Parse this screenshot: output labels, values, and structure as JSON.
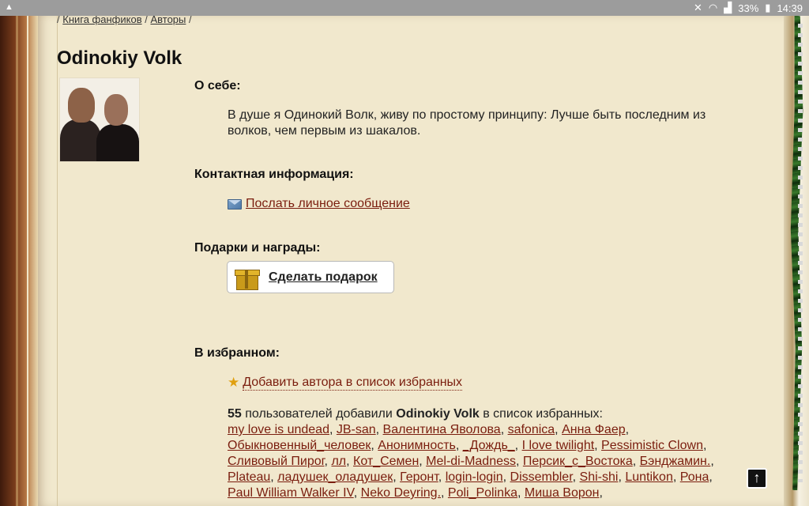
{
  "status_bar": {
    "battery": "33%",
    "time": "14:39"
  },
  "breadcrumb": {
    "separator": "/",
    "items": [
      "Книга фанфиков",
      "Авторы"
    ]
  },
  "author": {
    "name": "Odinokiy Volk"
  },
  "about": {
    "heading": "О себе:",
    "text": "В душе я Одинокий Волк, живу по простому принципу: Лучше быть последним из волков, чем первым из шакалов."
  },
  "contact": {
    "heading": "Контактная информация:",
    "message_link": "Послать личное сообщение"
  },
  "gifts": {
    "heading": "Подарки и награды:",
    "button_label": "Сделать подарок"
  },
  "favorites": {
    "heading": "В избранном:",
    "add_link": "Добавить автора в список избранных",
    "count": "55",
    "count_text": "пользователей добавили",
    "author_name": "Odinokiy Volk",
    "count_suffix": "в список избранных:",
    "users": [
      "my love is undead",
      "JB-san",
      "Валентина Яволова",
      "safonica",
      "Анна Фаер",
      "Обыкновенный_человек",
      "Анонимность",
      "_Дождь_",
      "I love twilight",
      "Pessimistic Clown",
      "Сливовый Пирог",
      "лл",
      "Кот_Семен",
      "Mel-di-Madness",
      "Персик_с_Востока",
      "Бэнджамин.",
      "Plateau",
      "ладушек_оладушек",
      "Геронт",
      "login-login",
      "Dissembler",
      "Shi-shi",
      "Luntikon",
      "Рона",
      "Paul William Walker IV",
      "Neko Deyring.",
      "Poli_Polinka",
      "Миша Ворон"
    ]
  }
}
